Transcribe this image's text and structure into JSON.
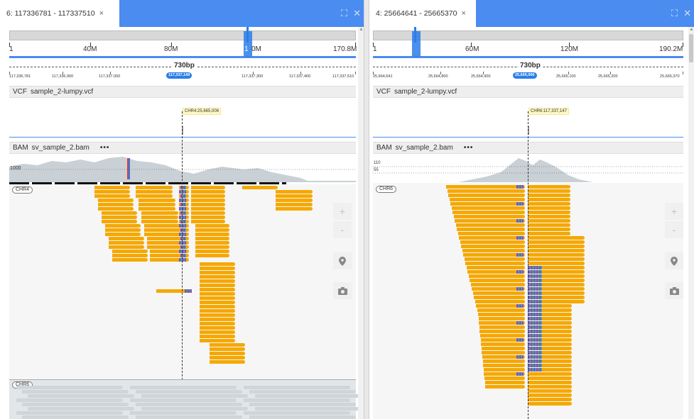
{
  "panels": [
    {
      "tab_title": "6: 117336781 - 117337510",
      "close_label": "×",
      "ideogram_labels": [
        "1",
        "40M",
        "80M",
        "1",
        "0M",
        "170.8M"
      ],
      "bp_label": "730bp",
      "positions": [
        "117,336,781",
        "117,336,900",
        "117,337,000",
        "117,337,300",
        "117,337,400",
        "117,337,510"
      ],
      "current_position": "117,337,149",
      "vcf": {
        "label": "VCF",
        "file": "sample_2-lumpy.vcf",
        "tooltip": "CHR4:25,665,006"
      },
      "bam": {
        "label": "BAM",
        "file": "sv_sample_2.bam",
        "menu": "•••"
      },
      "coverage_scale": [
        "1000"
      ],
      "chromosomes": [
        "CHR4",
        "CHR6"
      ]
    },
    {
      "tab_title": "4: 25664641 - 25665370",
      "close_label": "×",
      "ideogram_labels": [
        "1",
        "60M",
        "120M",
        "190.2M"
      ],
      "bp_label": "730bp",
      "positions": [
        "25,664,641",
        "25,664,800",
        "25,664,900",
        "25,665,100",
        "25,665,200",
        "25,665,370"
      ],
      "current_position": "25,665,006",
      "vcf": {
        "label": "VCF",
        "file": "sample_2-lumpy.vcf",
        "tooltip": "CHR6:117,337,147"
      },
      "bam": {
        "label": "BAM",
        "file": "sv_sample_2.bam",
        "menu": "•••"
      },
      "coverage_scale": [
        "110",
        "55"
      ],
      "chromosomes": [
        "CHR6"
      ]
    }
  ],
  "icons": {
    "maximize": "⛶",
    "close": "✕",
    "zoom_in": "+",
    "zoom_out": "-",
    "location": "location-pin-icon",
    "camera": "camera-icon"
  },
  "colors": {
    "accent": "#4a8cf0",
    "read": "#f5a800",
    "mismatch": "#8a4fb5",
    "coverage": "#c9d1d6"
  }
}
